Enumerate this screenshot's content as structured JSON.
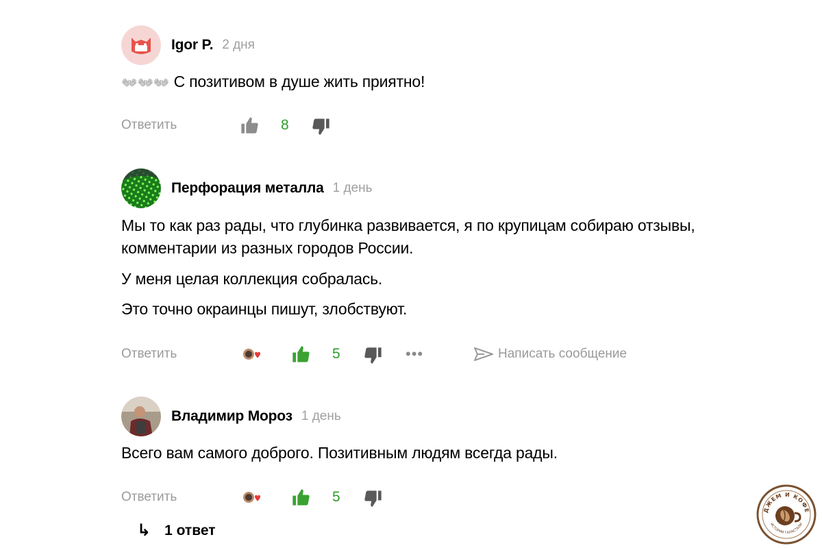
{
  "comments": [
    {
      "author": "Igor P.",
      "time": "2 дня",
      "emoji": "👐👐👐",
      "paragraphs": [
        "С позитивом в душе жить приятно!"
      ],
      "reply_label": "Ответить",
      "likes": "8"
    },
    {
      "author": "Перфорация металла",
      "time": "1 день",
      "paragraphs": [
        "Мы то как раз рады, что глубинка развивается, я по крупицам собираю отзывы,",
        "комментарии из разных городов России.",
        "У меня целая коллекция собралась.",
        "Это точно окраинцы пишут, злобствуют."
      ],
      "reply_label": "Ответить",
      "likes": "5",
      "more": "•••",
      "message_label": "Написать сообщение"
    },
    {
      "author": "Владимир Мороз",
      "time": "1 день",
      "paragraphs": [
        "Всего вам самого доброго. Позитивным людям всегда рады."
      ],
      "reply_label": "Ответить",
      "likes": "5"
    }
  ],
  "replies": {
    "arrow": "↳",
    "label": "1 ответ"
  },
  "logo": {
    "text": "ДЖЕМ И КОФЕ",
    "subtext": "ИСТОРИИ ГАЛАСТАЛИ"
  },
  "colors": {
    "like_active": "#3aa231",
    "like_count": "#2e9d2a",
    "muted": "#9a9a9a"
  }
}
